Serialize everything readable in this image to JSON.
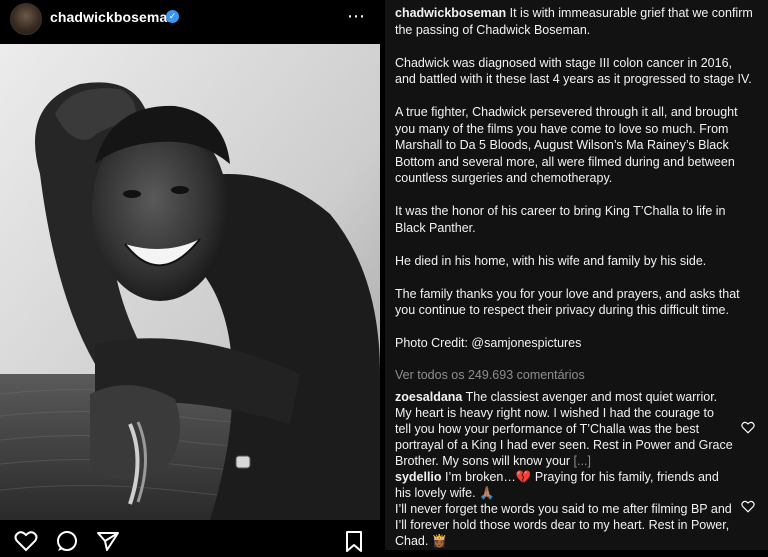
{
  "post": {
    "username": "chadwickboseman",
    "more_icon": "⋯",
    "photo_alt": "black-and-white portrait"
  },
  "caption": {
    "username": "chadwickboseman",
    "paragraphs": [
      "It is with immeasurable grief that we confirm the passing of Chadwick Boseman.",
      "Chadwick was diagnosed with stage III colon cancer in 2016, and battled with it these last 4 years as it progressed to stage IV.",
      "A true fighter, Chadwick persevered through it all, and brought you many of the films you have come to love so much. From Marshall to Da 5 Bloods, August Wilson’s Ma Rainey’s Black Bottom and several more, all were filmed during and between countless surgeries and chemotherapy.",
      "It was the honor of his career to bring King T’Challa to life in Black Panther.",
      "He died in his home, with his wife and family by his side.",
      "The family thanks you for your love and prayers, and asks that you continue to respect their privacy during this difficult time.",
      "Photo Credit: @samjonespictures"
    ]
  },
  "view_all": "Ver todos os 249.693 comentários",
  "comments": [
    {
      "username": "zoesaldana",
      "text": "The classiest avenger and most quiet warrior. My heart is heavy right now. I wished I had the courage to tell you how your performance of T’Challa was the best portrayal of a King I had ever seen. Rest in Power and Grace Brother. My sons will know your",
      "more": "[...]"
    },
    {
      "username": "sydellio",
      "text": "I’m broken…💔 Praying for his family, friends and his lovely wife. 🙏🏽",
      "text2": "I’ll never forget the words you said to me after filming BP and I’ll forever hold those words dear to my heart. Rest in Power, Chad. 👸🏾"
    }
  ],
  "icons": {
    "verified": "verified-badge-icon",
    "like": "heart-icon",
    "comment": "comment-icon",
    "share": "share-icon",
    "save": "bookmark-icon"
  },
  "colors": {
    "background_left": "#000000",
    "background_right": "#121212",
    "text": "#f2f2f2",
    "muted": "#8e8e8e",
    "verified": "#3897f0"
  }
}
